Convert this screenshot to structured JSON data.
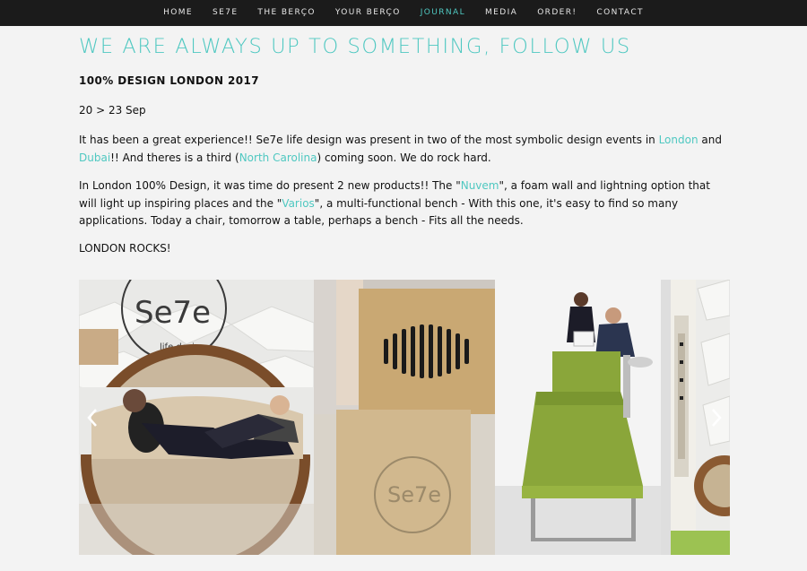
{
  "nav": {
    "items": [
      {
        "label": "HOME",
        "active": false
      },
      {
        "label": "SE7E",
        "active": false
      },
      {
        "label": "THE BERÇO",
        "active": false
      },
      {
        "label": "YOUR BERÇO",
        "active": false
      },
      {
        "label": "JOURNAL",
        "active": true
      },
      {
        "label": "MEDIA",
        "active": false
      },
      {
        "label": "ORDER!",
        "active": false
      },
      {
        "label": "CONTACT",
        "active": false
      }
    ]
  },
  "colors": {
    "accent": "#4fc8c1",
    "nav_bg": "#1b1b1b",
    "page_bg": "#f3f3f3"
  },
  "headline": "WE ARE ALWAYS UP TO SOMETHING, FOLLOW US",
  "post": {
    "title": "100% DESIGN LONDON 2017",
    "date": "20 > 23 Sep",
    "p1": {
      "t1": "It has been a great experience!! Se7e life design was present in two of the most symbolic design events in ",
      "link1": "London",
      "t2": " and ",
      "link2": "Dubai",
      "t3": "!! And theres is a third (",
      "link3": "North Carolina",
      "t4": ") coming soon. We do rock hard."
    },
    "p2": {
      "t1": "In London 100% Design, it was time do present 2 new products!! The \"",
      "link1": "Nuvem",
      "t2": "\", a foam wall and lightning option that will light up inspiring places and the \"",
      "link2": "Varios",
      "t3": "\", a multi-functional bench - With this one, it's easy to find so many applications. Today a chair, tomorrow a table, perhaps a bench - Fits all the needs."
    },
    "closing": "LONDON ROCKS!"
  },
  "gallery": {
    "logo_text": "Se7e",
    "logo_sub": "life design",
    "icons": {
      "prev": "chevron-left-icon",
      "next": "chevron-right-icon"
    }
  }
}
